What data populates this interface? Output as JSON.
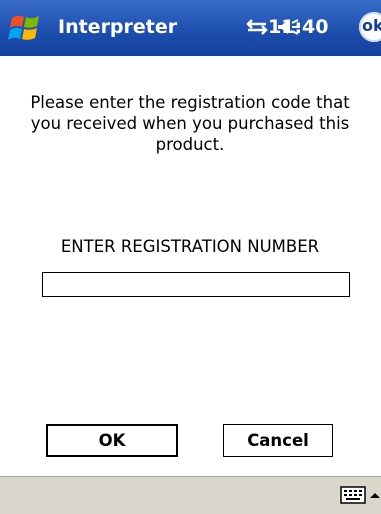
{
  "title_bar": {
    "app_title": "Interpreter",
    "clock": "11:40",
    "ok_label": "ok",
    "icons": {
      "start": "windows-flag-icon",
      "connectivity": "connectivity-icon",
      "volume": "speaker-volume-icon"
    }
  },
  "dialog": {
    "instructions": "Please enter the registration code that you received when you purchased this product.",
    "field_label": "ENTER REGISTRATION NUMBER",
    "registration_value": "",
    "buttons": {
      "ok": "OK",
      "cancel": "Cancel"
    }
  },
  "menu_bar": {
    "icons": {
      "keyboard": "keyboard-icon",
      "sip": "up-arrow-icon"
    }
  },
  "colors": {
    "title_bar": "#1d4fb0",
    "menu_bar": "#dbd6cc",
    "text": "#000000"
  }
}
